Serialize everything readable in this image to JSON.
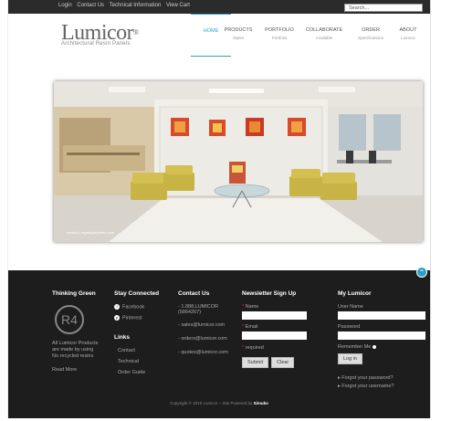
{
  "top_links": [
    "Login",
    "Contact Us",
    "Technical Information",
    "View Cart"
  ],
  "search": {
    "placeholder": "Search..."
  },
  "logo": {
    "name": "Lumicor",
    "reg": "®",
    "tagline": "Architectural Resin Panels"
  },
  "nav": [
    {
      "label": "HOME",
      "sub": ""
    },
    {
      "label": "PRODUCTS",
      "sub": "Styles"
    },
    {
      "label": "PORTFOLIO",
      "sub": "Portfolio"
    },
    {
      "label": "COLLABORATE",
      "sub": "Available"
    },
    {
      "label": "ORDER",
      "sub": "Specifications"
    },
    {
      "label": "ABOUT",
      "sub": "Lumicor"
    }
  ],
  "hero": {
    "caption": "lumicor | mystiqueryform.com"
  },
  "footer": {
    "thinking_green": {
      "heading": "Thinking Green",
      "logo_text": "R4",
      "text": [
        "All Lumicor Products",
        "are made by using",
        "No recycled resins"
      ],
      "read_more": "Read More"
    },
    "stay_connected": {
      "heading": "Stay Connected",
      "items": [
        "Facebook",
        "Pinterest"
      ],
      "links_heading": "Links",
      "links": [
        "Contact",
        "Technical",
        "Order Guide"
      ]
    },
    "contact": {
      "heading": "Contact Us",
      "items": [
        "- 1.888.LUMICOR (5864267)",
        "- sales@lumicor.com",
        "- orders@lumicor.com",
        "- quotes@lumicor.com"
      ]
    },
    "newsletter": {
      "heading": "Newsletter Sign Up",
      "name_label": "Name",
      "email_label": "Email",
      "required_note": "required",
      "submit": "Submit",
      "clear": "Clear"
    },
    "my_lumicor": {
      "heading": "My Lumicor",
      "username_label": "User Name",
      "password_label": "Password",
      "remember_label": "Remember Me",
      "login_button": "Log in",
      "forgot_password": "Forgot your password?",
      "forgot_username": "Forgot your username?"
    },
    "copyright": "Copyright © 2010 Lumicor – Site Powered by",
    "powered_by": "Simuko"
  },
  "colors": {
    "accent": "#2aa0c8",
    "footer_bg": "#1d1d1d",
    "topbar_bg": "#2b2b2b"
  }
}
